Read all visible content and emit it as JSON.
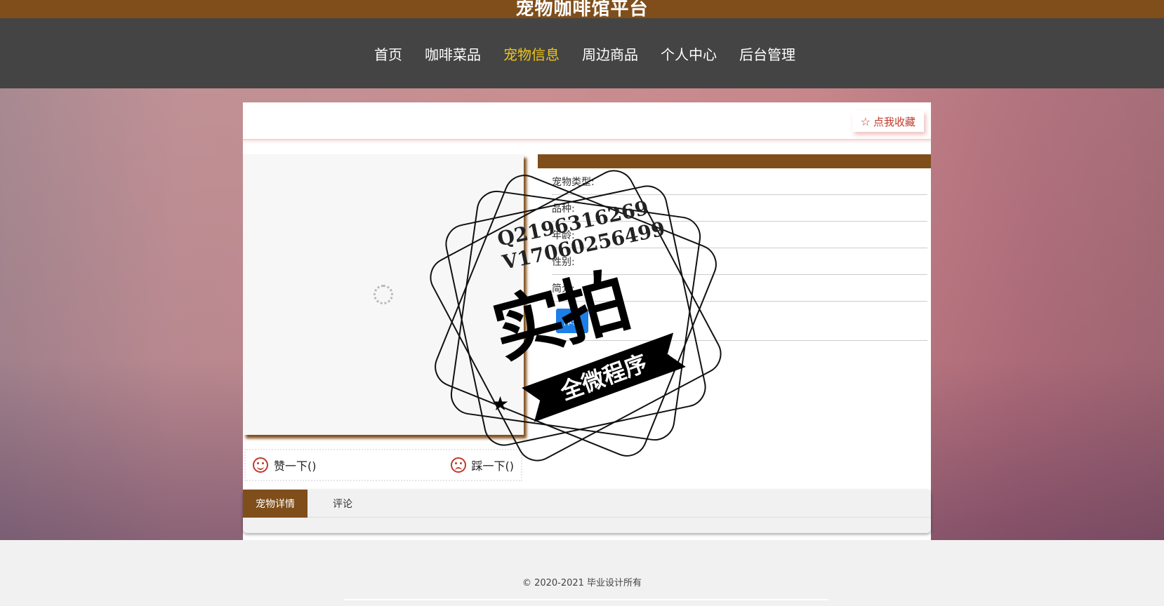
{
  "header": {
    "site_title": "宠物咖啡馆平台",
    "nav": [
      {
        "label": "首页",
        "active": false
      },
      {
        "label": "咖啡菜品",
        "active": false
      },
      {
        "label": "宠物信息",
        "active": true
      },
      {
        "label": "周边商品",
        "active": false
      },
      {
        "label": "个人中心",
        "active": false
      },
      {
        "label": "后台管理",
        "active": false
      }
    ]
  },
  "detail": {
    "favorite_label": "点我收藏",
    "fields": [
      {
        "label": "宠物类型:"
      },
      {
        "label": "品种:"
      },
      {
        "label": "年龄:"
      },
      {
        "label": "性别:"
      },
      {
        "label": "简介:"
      }
    ],
    "try_button": "体验",
    "like_label": "赞一下()",
    "dislike_label": "踩一下()"
  },
  "tabs": [
    {
      "label": "宠物详情",
      "active": true
    },
    {
      "label": "评论",
      "active": false
    }
  ],
  "watermark": {
    "line1": "Q2196316269",
    "line2": "V17060256499",
    "big": "实拍",
    "banner": "全微程序"
  },
  "footer": {
    "copyright": "© 2020-2021 毕业设计所有"
  },
  "colors": {
    "brand_brown": "#7f4e1a",
    "nav_bg": "#444444",
    "nav_active": "#f0c419",
    "accent_red": "#c0392b",
    "button_blue": "#1d7ee8"
  }
}
